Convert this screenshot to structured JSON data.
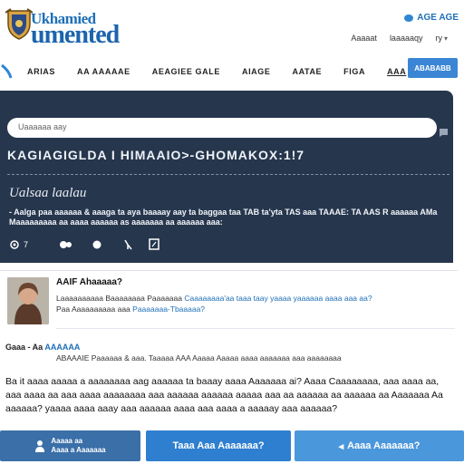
{
  "header": {
    "logo_line1": "Ukhamied",
    "logo_line2": "umented",
    "top_right": "AGE AGE",
    "top_links": [
      "Aaaaat",
      "laaaaaqy",
      "ry"
    ]
  },
  "nav": {
    "items": [
      "ARIAS",
      "AA AAAAAE",
      "AEAGIEE GALE",
      "AIAGE",
      "AATAE",
      "FIGA",
      "AAA"
    ],
    "button": "ABABABB"
  },
  "panel": {
    "search_placeholder": "Uaaaaaa aay",
    "headline": "KAGIAGIGLDA I HIMAAIO>-GHOMAKOX:1!7",
    "author": "Ualsaa laalau",
    "body": "- Aalga paa aaaaaa & aaaga ta aya baaaay aay ta baggaa taa TAB ta'yta TAS aaa TAAAE: TA AAS R aaaaaa AMa Maaaaaaaaa aa aaaa aaaaaa as aaaaaaa aa aaaaaa aaa:",
    "icon_count": "7"
  },
  "card": {
    "title": "AAIF Ahaaaaa?",
    "question_prefix": "Laaaaaaaaaa Baaaaaaaa Paaaaaaa",
    "question_link": "Caaaaaaaa'aa taaa taay yaaaa yaaaaaa aaaa aaa aa?",
    "sub_prefix": "Paa Aaaaaaaaaa aaa",
    "sub_link": "Paaaaaaa-Tbaaaaa?",
    "tags_prefix": "Gaaa - Aa",
    "tags_link": "AAAAAA",
    "meta": "ABAAAIE Paaaaaa & aaa. Taaaaa AAA Aaaaa Aaaaa aaaa aaaaaaa aaa aaaaaaaa",
    "paragraph": "Ba it aaaa aaaaa a aaaaaaaa aag aaaaaa ta baaay aaaa Aaaaaaa ai? Aaaa Caaaaaaaa, aaa aaaa aa, aaa aaaa aa aaa aaaa aaaaaaaa aaa aaaaaa aaaaaa aaaaa aaa aa aaaaaa aa aaaaaa aa Aaaaaaa Aa aaaaaa? yaaaa aaaa aaay aaa aaaaaa aaaa aaa aaaa a aaaaay aaa aaaaaa?"
  },
  "buttons": {
    "b1_top": "Aaaaa aa",
    "b1_bottom": "Aaaa a Aaaaaaa",
    "b2": "Taaa Aaa Aaaaaaa?",
    "b3": "Aaaa Aaaaaaa?"
  },
  "colors": {
    "brand_blue": "#1e6fb7",
    "panel": "#26364d",
    "button_mid": "#2f7fd0"
  }
}
